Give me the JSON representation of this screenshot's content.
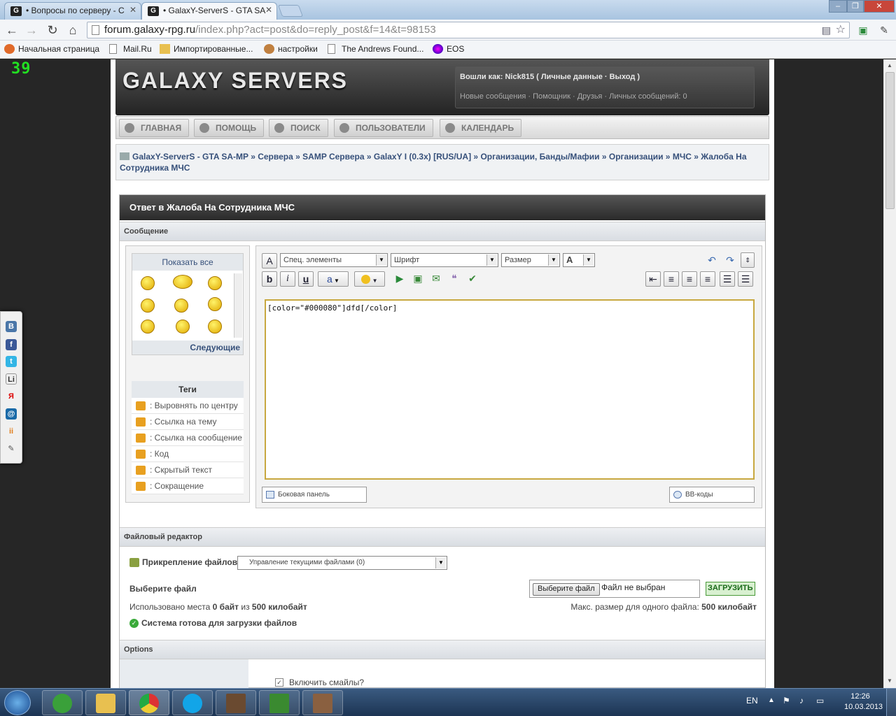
{
  "browser": {
    "tabs": [
      {
        "label": "• Вопросы по серверу - С"
      },
      {
        "label": "• GalaxY-ServerS - GTA SA"
      }
    ],
    "url_host": "forum.galaxy-rpg.ru",
    "url_rest": "/index.php?act=post&do=reply_post&f=14&t=98153",
    "bookmarks": [
      "Начальная страница",
      "Mail.Ru",
      "Импортированные...",
      "настройки",
      "The Andrews Found...",
      "EOS"
    ]
  },
  "counter": "39",
  "header": {
    "logo": "GALAXY SERVERS",
    "user_line": "Вошли как: Nick815 ( Личные данные · Выход )",
    "links_line": "Новые сообщения · Помощник · Друзья · Личных сообщений: 0"
  },
  "nav": [
    "ГЛАВНАЯ",
    "ПОМОЩЬ",
    "ПОИСК",
    "ПОЛЬЗОВАТЕЛИ",
    "КАЛЕНДАРЬ"
  ],
  "breadcrumb": [
    "GalaxY-ServerS - GTA SA-MP",
    "Сервера",
    "SAMP Сервера",
    "GalaxY I (0.3x) [RUS/UA]",
    "Организации, Банды/Мафии",
    "Организации",
    "МЧС",
    "Жалоба На Сотрудника МЧС"
  ],
  "breadcrumb_sep": "»",
  "main": {
    "title": "Ответ в Жалоба На Сотрудника МЧС",
    "message_header": "Сообщение",
    "show_all": "Показать все",
    "next": "Следующие",
    "tags_title": "Теги",
    "tags": [
      ": Выровнять по центру",
      ": Ссылка на тему",
      ": Ссылка на сообщение",
      ": Код",
      ": Скрытый текст",
      ": Сокращение"
    ],
    "editor": {
      "special": "Спец. элементы",
      "font": "Шрифт",
      "size": "Размер",
      "color_btn": "A",
      "bold": "b",
      "italic": "i",
      "underline": "u",
      "text": "[color=\"#000080\"]dfd[/color]",
      "sidebar_btn": "Боковая панель",
      "bbcode_btn": "BB-коды"
    },
    "file_header": "Файловый редактор",
    "attach_label": "Прикрепление файлов",
    "attach_select": "Управление текущими файлами (0)",
    "choose_file_label": "Выберите файл",
    "choose_file_btn": "Выберите файл",
    "no_file": "Файл не выбран",
    "upload_btn": "ЗАГРУЗИТЬ",
    "used_space_prefix": "Использовано места ",
    "used_space_value": "0 байт",
    "used_space_mid": " из ",
    "used_space_total": "500 килобайт",
    "max_size_prefix": "Макс. размер для одного файла: ",
    "max_size_value": "500 килобайт",
    "ready": "Система готова для загрузки файлов",
    "options_header": "Options",
    "smiles_label": "Включить смайлы?"
  },
  "taskbar": {
    "lang": "EN",
    "time": "12:26",
    "date": "10.03.2013"
  },
  "social": [
    "В",
    "f",
    "t",
    "Li",
    "Я",
    "@",
    "ii",
    "✎"
  ]
}
